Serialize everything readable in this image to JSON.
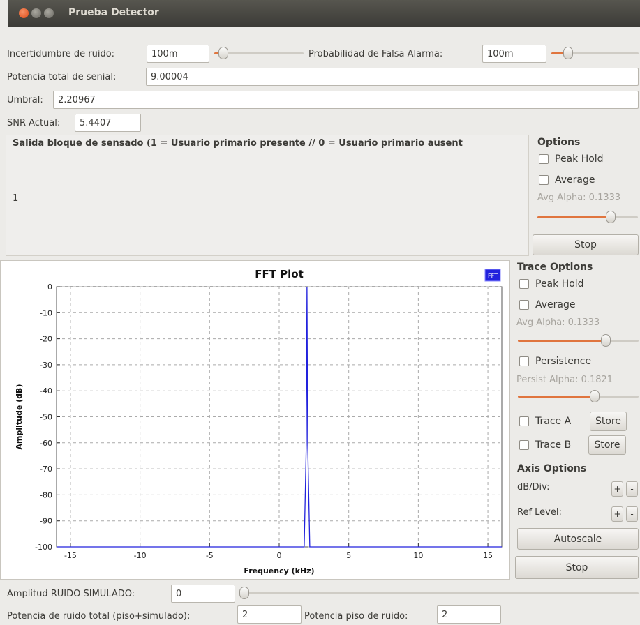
{
  "window": {
    "title": "Prueba Detector"
  },
  "controls": {
    "noise_uncertainty": {
      "label": "Incertidumbre de ruido:",
      "value": "100m",
      "level": 0.05
    },
    "false_alarm_prob": {
      "label": "Probabilidad de Falsa Alarma:",
      "value": "100m",
      "level": 0.15
    },
    "total_signal_power": {
      "label": "Potencia total de senial:",
      "value": "9.00004"
    },
    "threshold": {
      "label": "Umbral:",
      "value": "2.20967"
    },
    "snr": {
      "label": "SNR Actual:",
      "value": "5.4407"
    }
  },
  "sensing_output": {
    "title": "Salida bloque de sensado (1 = Usuario primario presente // 0 = Usuario primario ausent",
    "value": "1",
    "options": {
      "title": "Options",
      "peak_hold": "Peak Hold",
      "average": "Average",
      "avg_alpha": "Avg Alpha: 0.1333",
      "avg_alpha_level": 0.75,
      "stop": "Stop"
    }
  },
  "fft": {
    "trace_options": {
      "title": "Trace Options",
      "peak_hold": "Peak Hold",
      "average": "Average",
      "avg_alpha": "Avg Alpha: 0.1333",
      "avg_alpha_level": 0.75,
      "persistence": "Persistence",
      "persist_alpha": "Persist Alpha: 0.1821",
      "persist_alpha_level": 0.65,
      "trace_a": "Trace A",
      "trace_b": "Trace B",
      "store": "Store"
    },
    "axis_options": {
      "title": "Axis Options",
      "db_div": "dB/Div:",
      "ref_level": "Ref Level:",
      "plus": "+",
      "minus": "-",
      "autoscale": "Autoscale",
      "stop": "Stop"
    }
  },
  "bottom": {
    "sim_noise_amp": {
      "label": "Amplitud RUIDO SIMULADO:",
      "value": "0",
      "level": 0.0
    },
    "total_noise_power": {
      "label": "Potencia de ruido total (piso+simulado):",
      "value": "2"
    },
    "noise_floor_power": {
      "label": "Potencia piso de ruido:",
      "value": "2"
    }
  },
  "chart_data": {
    "type": "line",
    "title": "FFT Plot",
    "xlabel": "Frequency (kHz)",
    "ylabel": "Amplitude (dB)",
    "xlim": [
      -16,
      16
    ],
    "ylim": [
      -100,
      0
    ],
    "xticks": [
      -15,
      -10,
      -5,
      0,
      5,
      10,
      15
    ],
    "yticks": [
      0,
      -10,
      -20,
      -30,
      -40,
      -50,
      -60,
      -70,
      -80,
      -90,
      -100
    ],
    "grid": true,
    "legend": "top-right",
    "series": [
      {
        "name": "FFT",
        "color": "#2222dd",
        "x": [
          -16,
          1.8,
          1.95,
          2.0,
          2.05,
          2.2,
          16
        ],
        "y": [
          -100,
          -100,
          -60,
          0,
          -60,
          -100,
          -100
        ]
      }
    ]
  }
}
